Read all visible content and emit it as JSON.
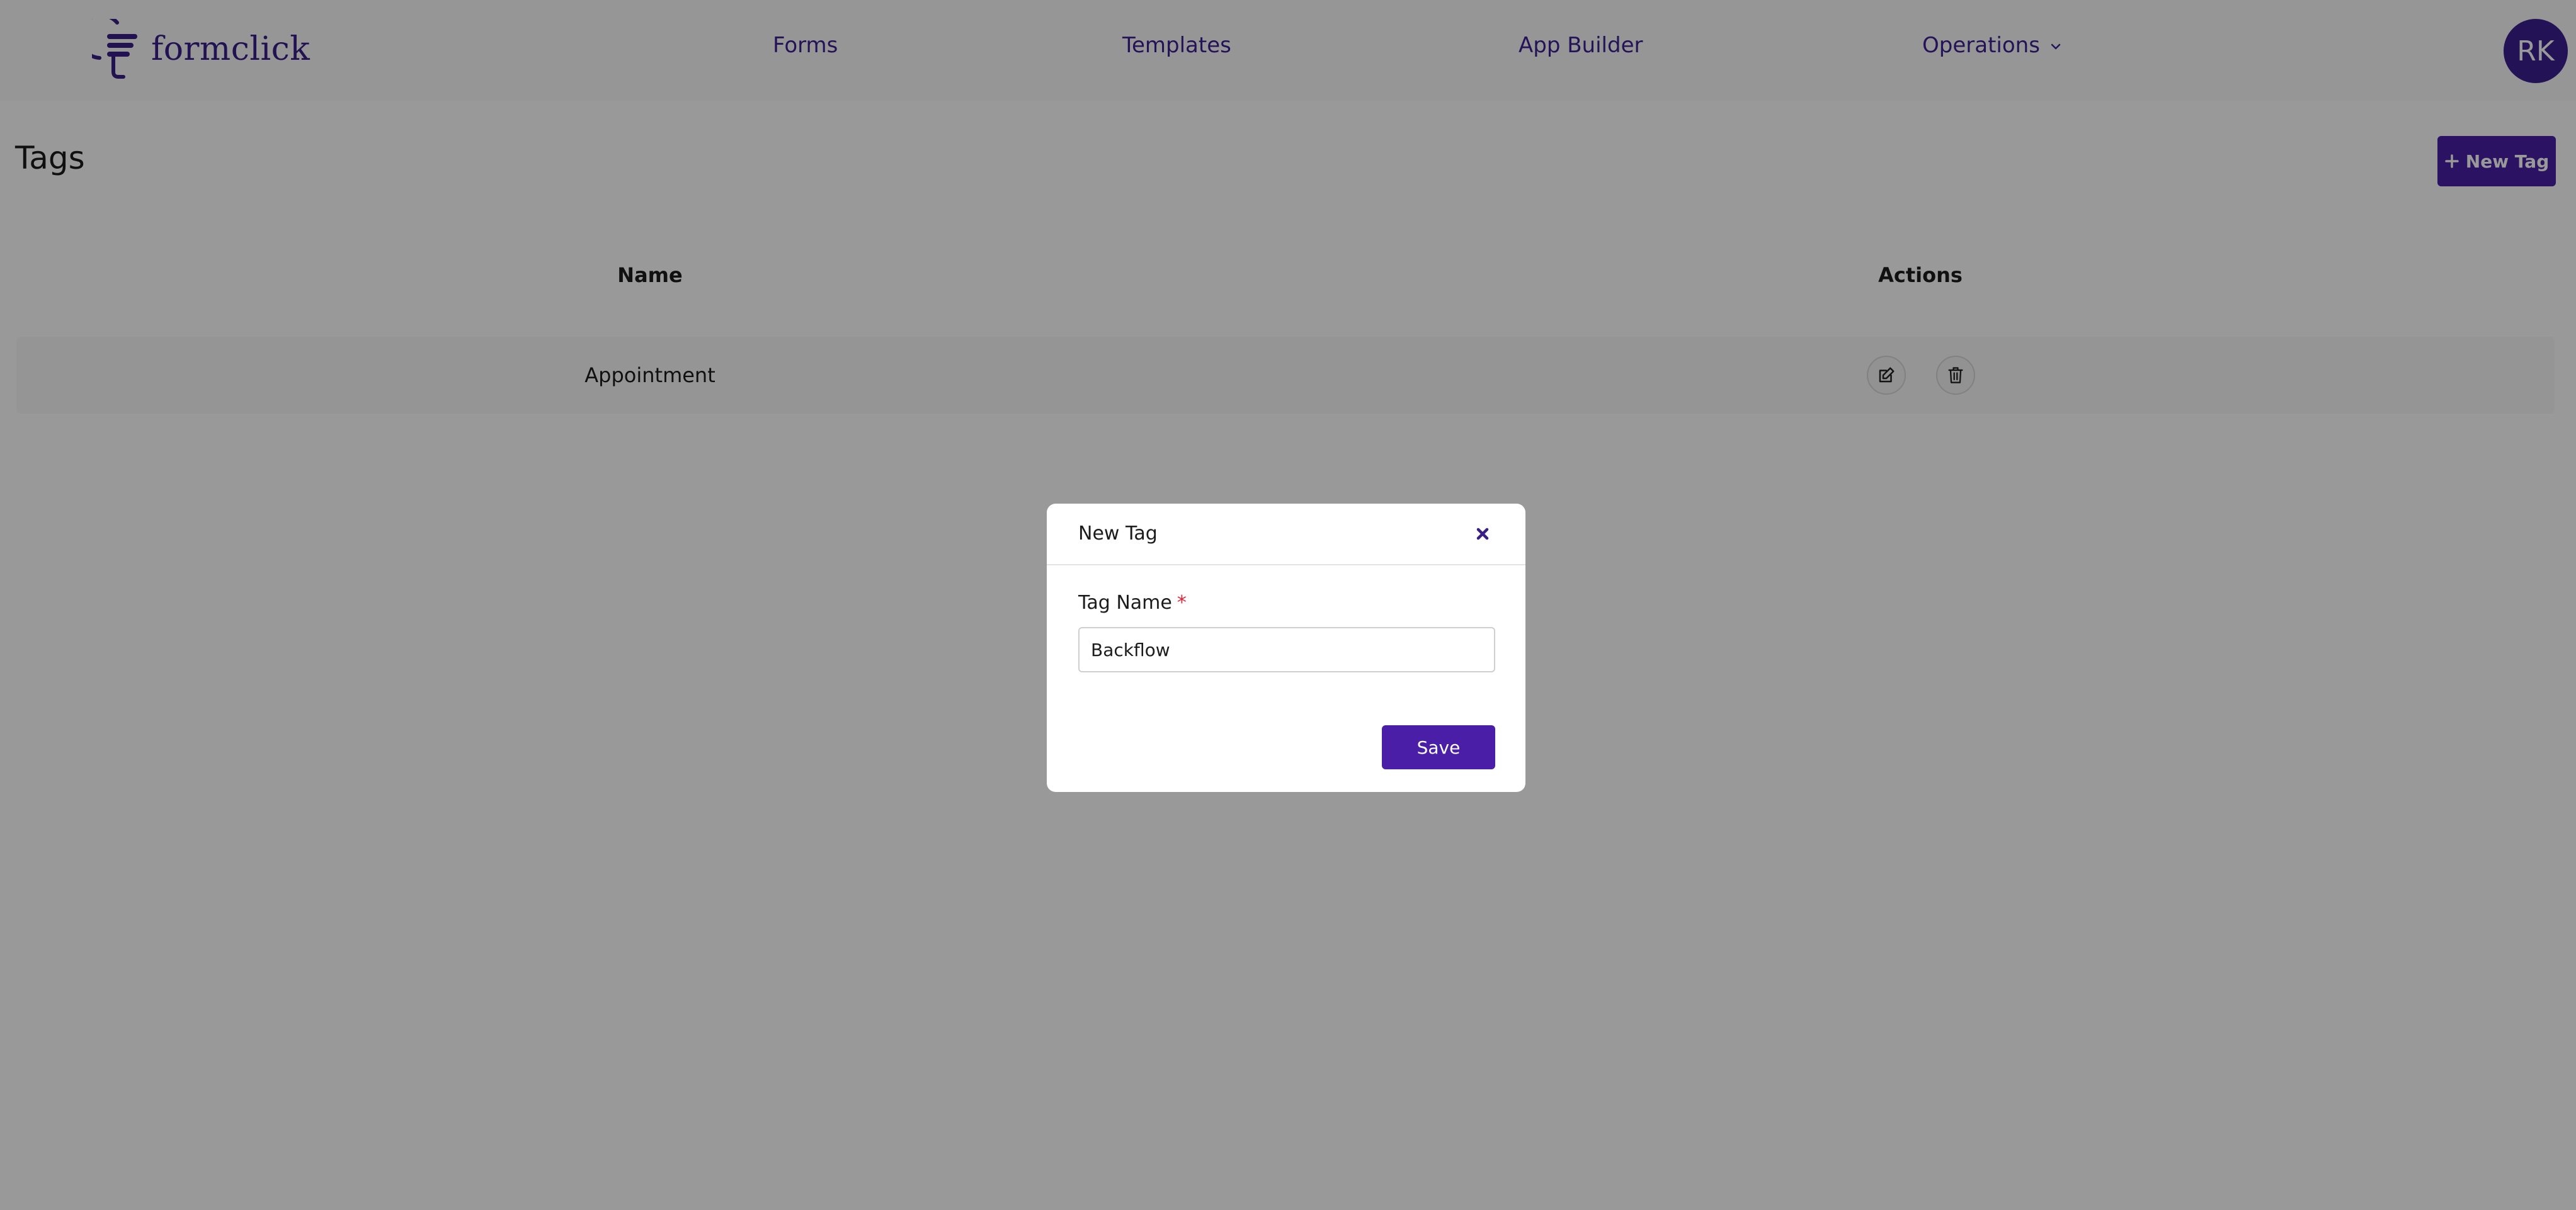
{
  "header": {
    "logo_text": "formclick",
    "nav": [
      {
        "label": "Forms"
      },
      {
        "label": "Templates"
      },
      {
        "label": "App Builder"
      },
      {
        "label": "Operations",
        "has_dropdown": true
      }
    ],
    "avatar_initials": "RK"
  },
  "page": {
    "title": "Tags",
    "new_tag_button": "New Tag",
    "table": {
      "columns": [
        "Name",
        "Actions"
      ],
      "rows": [
        {
          "name": "Appointment",
          "actions": [
            "edit-icon",
            "trash-icon"
          ]
        }
      ]
    }
  },
  "modal": {
    "title": "New Tag",
    "field_label": "Tag Name",
    "required_marker": "*",
    "field_value": "Backflow",
    "save_button": "Save"
  },
  "colors": {
    "brand": "#4a1ea6",
    "nav_text": "#3f2191",
    "required": "#e0263a",
    "overlay": "rgba(0,0,0,0.40)"
  }
}
